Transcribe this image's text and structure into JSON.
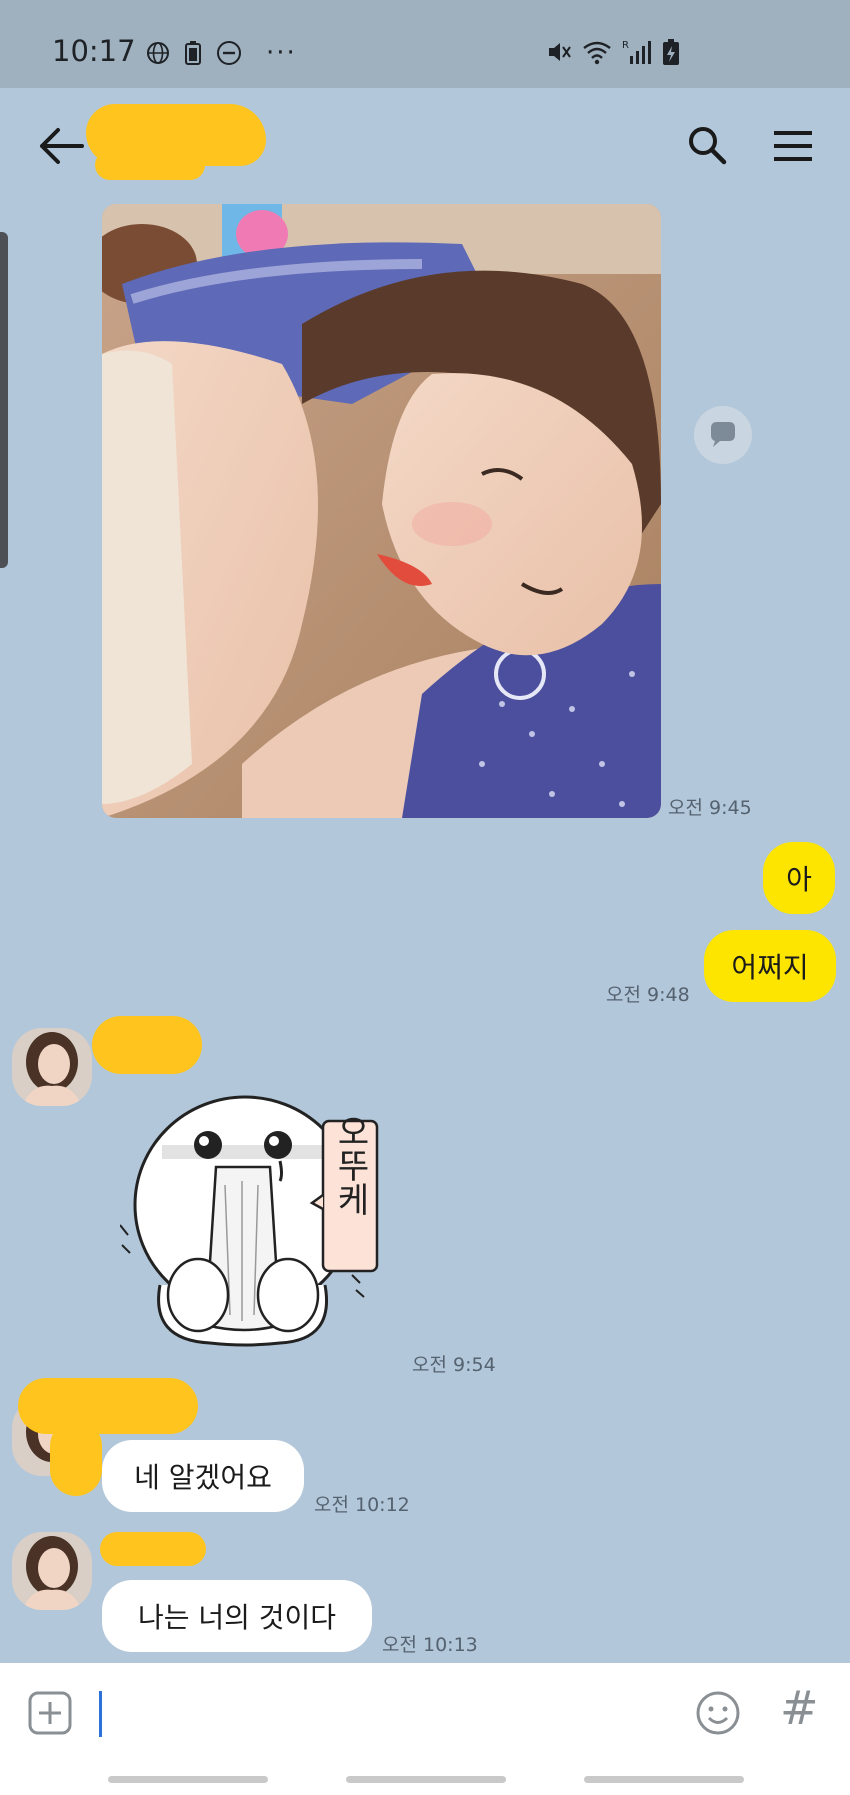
{
  "status_bar": {
    "time": "10:17",
    "left_icons": [
      "globe-icon",
      "battery-saver-icon",
      "do-not-disturb-icon",
      "more-dots-icon"
    ],
    "more_dots": "···",
    "right_icons": [
      "mute-icon",
      "wifi-icon",
      "signal-icon",
      "battery-charging-icon"
    ],
    "signal_roaming_mark": "R"
  },
  "header": {
    "back_icon": "arrow-left-icon",
    "search_icon": "search-icon",
    "menu_icon": "hamburger-menu-icon"
  },
  "messages": [
    {
      "type": "photo",
      "sender": "them",
      "time": "오전 9:45"
    },
    {
      "type": "text",
      "sender": "me",
      "text": "아"
    },
    {
      "type": "text",
      "sender": "me",
      "text": "어쩌지",
      "time": "오전 9:48"
    },
    {
      "type": "sticker",
      "sender": "them",
      "sticker_text": "오뚜케",
      "time": "오전 9:54"
    },
    {
      "type": "text",
      "sender": "them",
      "text": "네 알겠어요",
      "time": "오전 10:12"
    },
    {
      "type": "text",
      "sender": "them",
      "text": "나는 너의 것이다",
      "time": "오전 10:13"
    }
  ],
  "composer": {
    "input_value": "",
    "plus_icon": "plus-icon",
    "emoji_icon": "emoji-icon",
    "hashtag_label": "#"
  },
  "colors": {
    "chat_background": "#b2c7d9",
    "status_bar": "#9fb0be",
    "my_bubble": "#fee500",
    "their_bubble": "#ffffff",
    "redaction": "#ffc51e"
  }
}
